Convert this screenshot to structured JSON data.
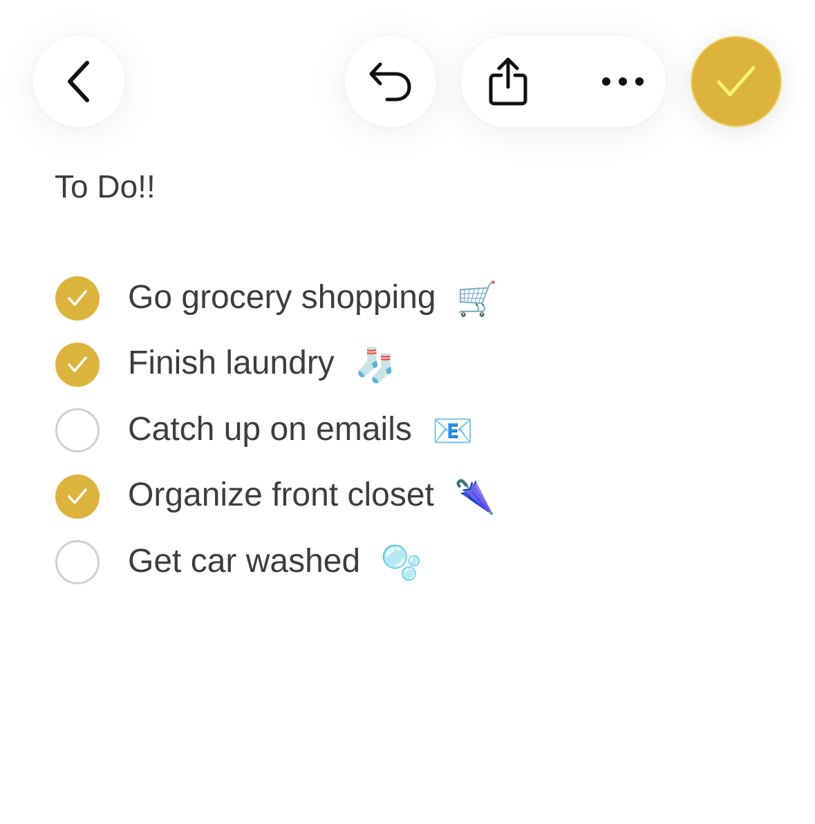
{
  "toolbar": {
    "back_icon": "chevron-left-icon",
    "undo_icon": "undo-arrow-icon",
    "share_icon": "share-icon",
    "more_icon": "ellipsis-icon",
    "done_icon": "checkmark-icon",
    "accent_color": "#dcb43d"
  },
  "note": {
    "title": "To Do!!",
    "items": [
      {
        "text": "Go grocery shopping",
        "emoji": "🛒",
        "emoji_icon": "shopping-cart-icon",
        "checked": true
      },
      {
        "text": "Finish laundry",
        "emoji": "🧦",
        "emoji_icon": "sock-icon",
        "checked": true
      },
      {
        "text": "Catch up on emails",
        "emoji": "📧",
        "emoji_icon": "email-icon",
        "checked": false
      },
      {
        "text": "Organize front closet",
        "emoji": "🌂",
        "emoji_icon": "closed-umbrella-icon",
        "checked": true
      },
      {
        "text": "Get car washed",
        "emoji": "🫧",
        "emoji_icon": "bubbles-icon",
        "checked": false
      }
    ]
  }
}
